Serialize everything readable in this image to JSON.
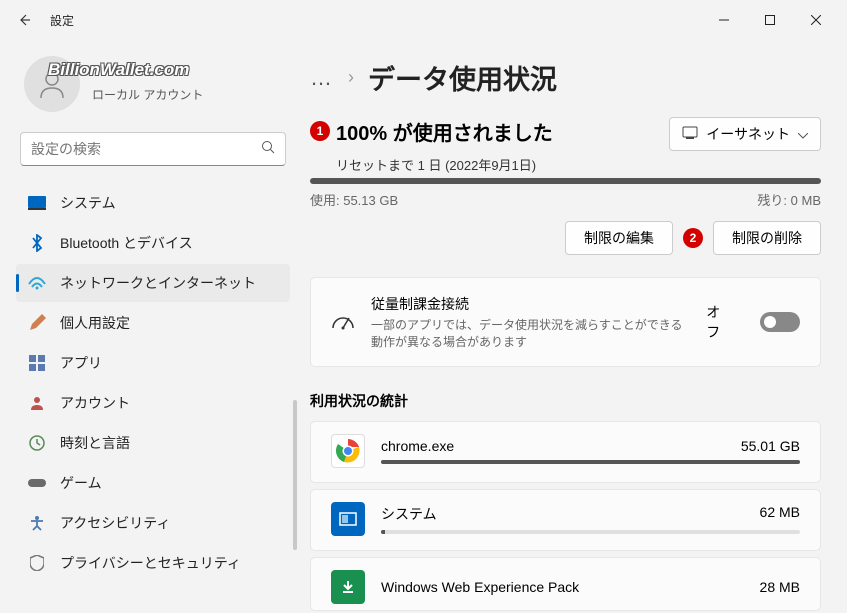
{
  "window": {
    "title": "設定"
  },
  "profile": {
    "watermark": "BillionWallet.com",
    "account_type": "ローカル アカウント"
  },
  "search": {
    "placeholder": "設定の検索"
  },
  "sidebar": {
    "items": [
      {
        "label": "システム"
      },
      {
        "label": "Bluetooth とデバイス"
      },
      {
        "label": "ネットワークとインターネット"
      },
      {
        "label": "個人用設定"
      },
      {
        "label": "アプリ"
      },
      {
        "label": "アカウント"
      },
      {
        "label": "時刻と言語"
      },
      {
        "label": "ゲーム"
      },
      {
        "label": "アクセシビリティ"
      },
      {
        "label": "プライバシーとセキュリティ"
      }
    ]
  },
  "breadcrumb": {
    "title": "データ使用状況"
  },
  "usage": {
    "badge": "1",
    "title": "100% が使用されました",
    "reset": "リセットまで 1 日 (2022年9月1日)",
    "used_label": "使用: 55.13 GB",
    "remain_label": "残り: 0 MB"
  },
  "network_select": {
    "label": "イーサネット"
  },
  "actions": {
    "edit": "制限の編集",
    "delete_badge": "2",
    "delete": "制限の削除"
  },
  "metered": {
    "title": "従量制課金接続",
    "sub": "一部のアプリでは、データ使用状況を減らすことができる動作が異なる場合があります",
    "state": "オフ"
  },
  "stats": {
    "title": "利用状況の統計",
    "apps": [
      {
        "name": "chrome.exe",
        "size": "55.01 GB",
        "pct": 100
      },
      {
        "name": "システム",
        "size": "62 MB",
        "pct": 1
      },
      {
        "name": "Windows Web Experience Pack",
        "size": "28 MB",
        "pct": 0
      }
    ]
  }
}
